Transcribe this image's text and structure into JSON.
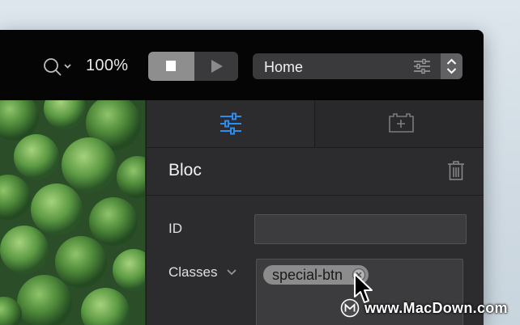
{
  "toolbar": {
    "zoom_level": "100%",
    "page_select": {
      "value": "Home"
    }
  },
  "panel": {
    "tabs": [
      {
        "name": "properties",
        "icon": "sliders-icon",
        "active": true,
        "color": "#2d8cf0"
      },
      {
        "name": "add-component",
        "icon": "add-component-icon",
        "active": false
      }
    ],
    "section_title": "Bloc",
    "fields": {
      "id_label": "ID",
      "id_value": "",
      "classes_label": "Classes",
      "classes": [
        "special-btn"
      ]
    }
  },
  "watermark": "www.MacDown.com",
  "colors": {
    "toolbar_bg": "#050505",
    "panel_bg": "#2c2c2e",
    "accent": "#2d8cf0",
    "chip_bg": "#8c8c8c"
  }
}
